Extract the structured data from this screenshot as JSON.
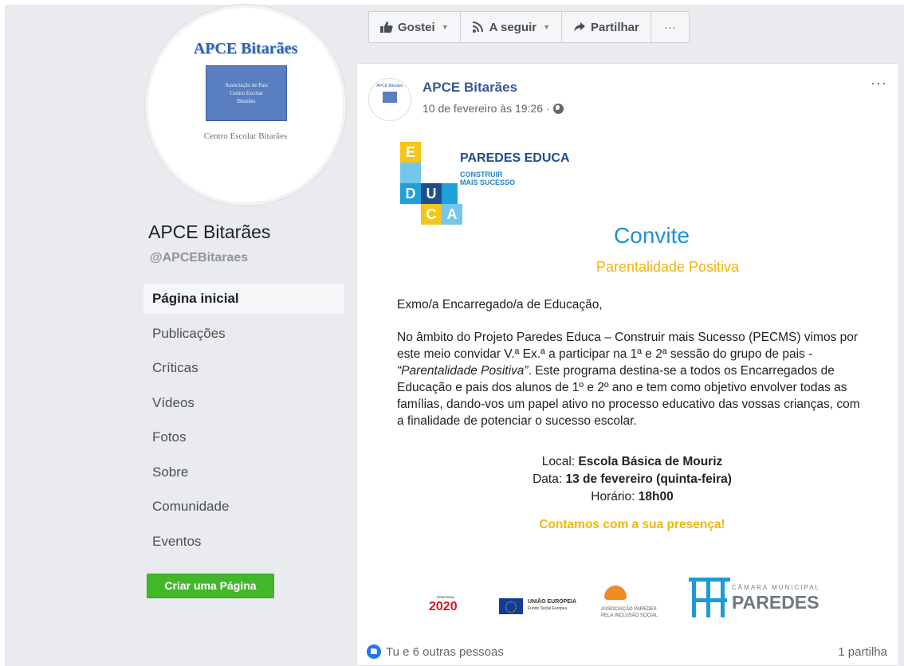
{
  "page": {
    "name": "APCE Bitarães",
    "handle": "@APCEBitaraes"
  },
  "profile_picture": {
    "title": "APCE Bitarães",
    "box_lines": [
      "Associação de Pais",
      "Centro Escolar",
      "Bitarães"
    ],
    "subtitle": "Centro Escolar Bitarães"
  },
  "nav": {
    "items": [
      {
        "label": "Página inicial",
        "active": true
      },
      {
        "label": "Publicações"
      },
      {
        "label": "Críticas"
      },
      {
        "label": "Vídeos"
      },
      {
        "label": "Fotos"
      },
      {
        "label": "Sobre"
      },
      {
        "label": "Comunidade"
      },
      {
        "label": "Eventos"
      }
    ],
    "create_page_label": "Criar uma Página"
  },
  "action_bar": {
    "like_label": "Gostei",
    "follow_label": "A seguir",
    "share_label": "Partilhar",
    "more_label": "···"
  },
  "post": {
    "author": "APCE Bitarães",
    "timestamp": "10 de fevereiro às 19:26 ·",
    "more_label": "···",
    "flyer": {
      "logo_letters": [
        "E",
        "D",
        "U",
        "C",
        "A"
      ],
      "program_title": "PAREDES EDUCA",
      "program_sub_1": "CONSTRUIR",
      "program_sub_2": "MAIS SUCESSO",
      "heading": "Convite",
      "subheading": "Parentalidade Positiva",
      "greeting": "Exmo/a Encarregado/a de Educação,",
      "body_1": "No âmbito do Projeto Paredes Educa – Construir mais Sucesso (PECMS) vimos por este meio convidar V.ª Ex.ª a participar na 1ª e 2ª sessão do grupo de pais - ",
      "body_em": "“Parentalidade Positiva”",
      "body_2": ". Este programa destina-se a todos os Encarregados de Educação e pais dos alunos de 1º e 2º ano e tem como objetivo envolver todas as famílias, dando-vos um papel ativo no processo educativo das vossas crianças, com a finalidade de potenciar o sucesso escolar.",
      "local_label": "Local: ",
      "local_value": "Escola Básica de Mouriz",
      "date_label": "Data: ",
      "date_value": "13 de fevereiro (quinta-feira)",
      "time_label": "Horário: ",
      "time_value": "18h00",
      "closing": "Contamos com a sua presença!",
      "sponsors": {
        "portugal_top": "PORTUGAL",
        "portugal": "2020",
        "eu_name": "UNIÃO EUROPEIA",
        "eu_fund": "Fundo Social Europeu",
        "assoc_1": "ASSOCIAÇÃO PAREDES",
        "assoc_2": "PELA INCLUSÃO SOCIAL",
        "cm_title": "CÂMARA MUNICIPAL",
        "cm_name": "PAREDES"
      }
    },
    "reactions_text": "Tu e 6 outras pessoas",
    "shares_text": "1 partilha"
  },
  "colors": {
    "background": "#e9ebee",
    "link": "#385898",
    "create_button": "#42b72a",
    "educa_yellow": "#f5c518",
    "educa_blue": "#1fa0d8",
    "educa_lightblue": "#74c6ea",
    "convite_blue": "#1e90d5",
    "accent_yellow": "#f5b400"
  },
  "icons": {
    "like": "thumbs-up-icon",
    "follow": "rss-icon",
    "share": "share-arrow-icon",
    "audience": "globe-icon"
  }
}
